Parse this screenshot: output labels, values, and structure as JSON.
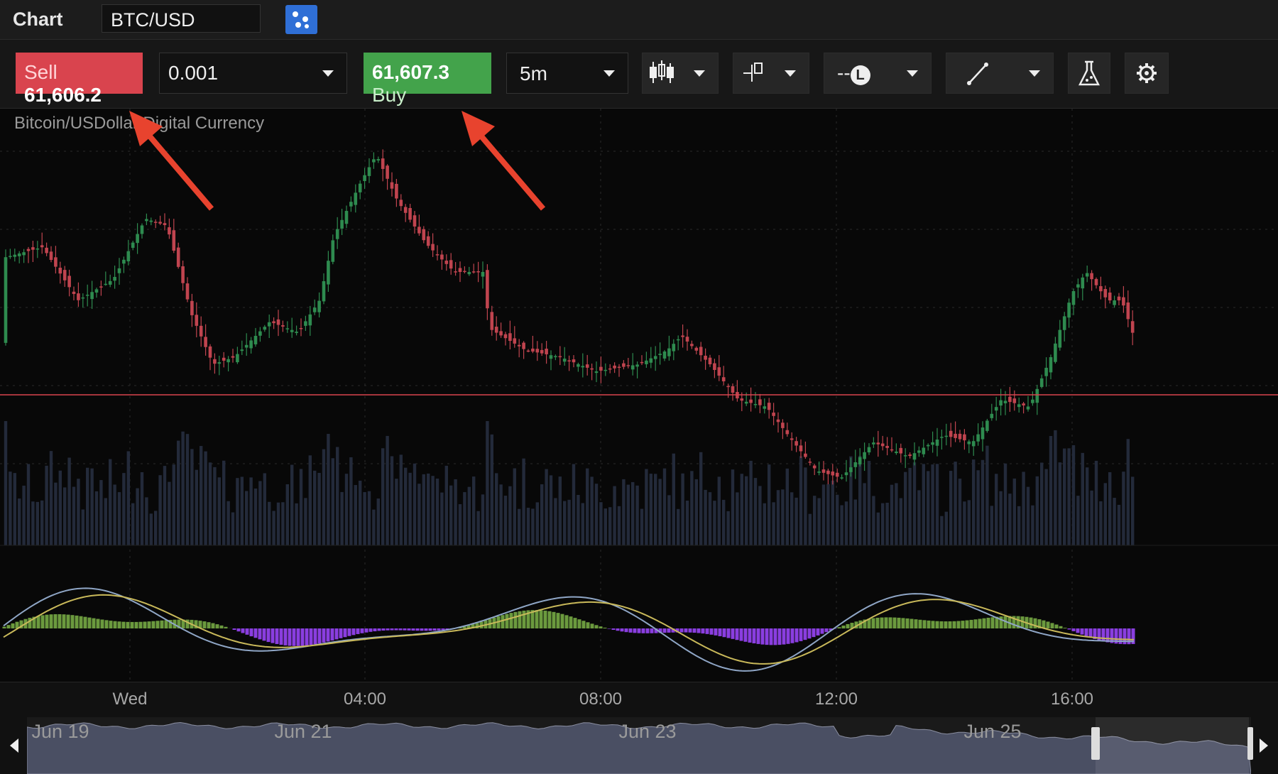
{
  "header": {
    "app_title": "Chart",
    "symbol": "BTC/USD"
  },
  "toolbar": {
    "sell_label": "Sell",
    "sell_price": "61,606.2",
    "quantity": "0.001",
    "buy_price": "61,607.3",
    "buy_label": "Buy",
    "interval": "5m",
    "line_style_label": "--",
    "line_style_symbol": "L"
  },
  "chart": {
    "description": "Bitcoin/USDollar Digital Currency",
    "time_labels": [
      "Wed",
      "04:00",
      "08:00",
      "12:00",
      "16:00"
    ],
    "navigator_labels": [
      "Jun 19",
      "Jun 21",
      "Jun 23",
      "Jun 25"
    ]
  },
  "colors": {
    "up": "#2e8b4f",
    "down": "#c0444f",
    "sell": "#d9444e",
    "buy": "#43a34b",
    "annotation": "#e8432e",
    "macd_pos": "#6b9a3e",
    "macd_neg": "#8a3ee0"
  },
  "icons": [
    "compare-icon",
    "chart-type-icon",
    "draw-tool-icon",
    "flask-icon",
    "gear-icon"
  ]
}
